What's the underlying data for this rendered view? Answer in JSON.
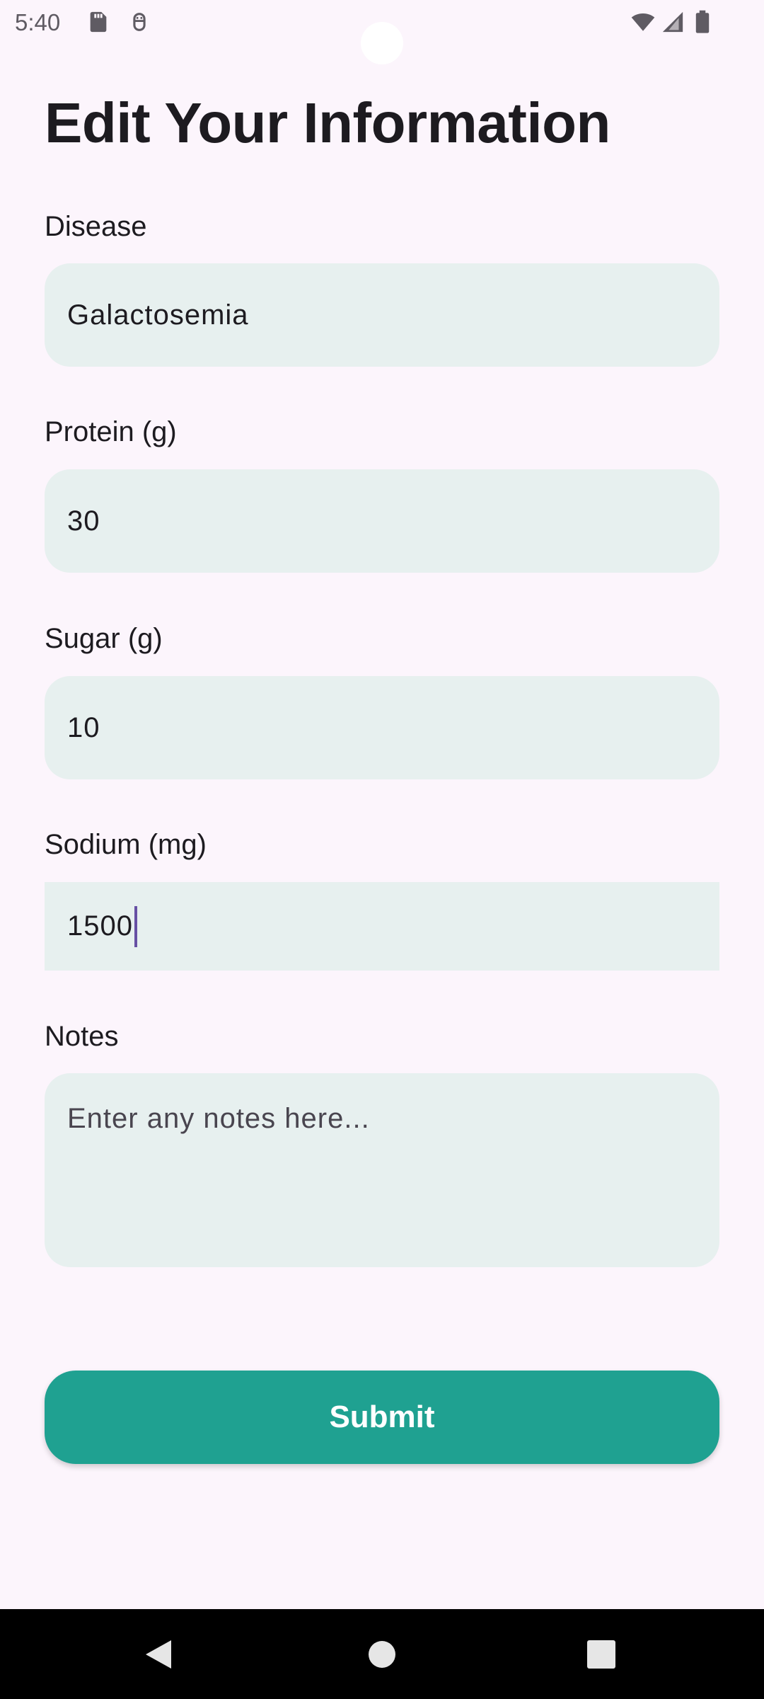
{
  "status_bar": {
    "time": "5:40",
    "icons": [
      "sd-card-icon",
      "debug-icon",
      "wifi-icon",
      "signal-icon",
      "battery-icon"
    ]
  },
  "page": {
    "title": "Edit Your Information"
  },
  "form": {
    "disease": {
      "label": "Disease",
      "value": "Galactosemia"
    },
    "protein": {
      "label": "Protein (g)",
      "value": "30"
    },
    "sugar": {
      "label": "Sugar (g)",
      "value": "10"
    },
    "sodium": {
      "label": "Sodium (mg)",
      "value": "1500"
    },
    "notes": {
      "label": "Notes",
      "placeholder": "Enter any notes here..."
    }
  },
  "actions": {
    "submit_label": "Submit"
  },
  "nav": {
    "icons": [
      "back-icon",
      "home-icon",
      "recents-icon"
    ]
  },
  "colors": {
    "background": "#FCF5FC",
    "field_fill": "#E7F0EF",
    "accent": "#1FA191",
    "caret": "#6750A4"
  }
}
